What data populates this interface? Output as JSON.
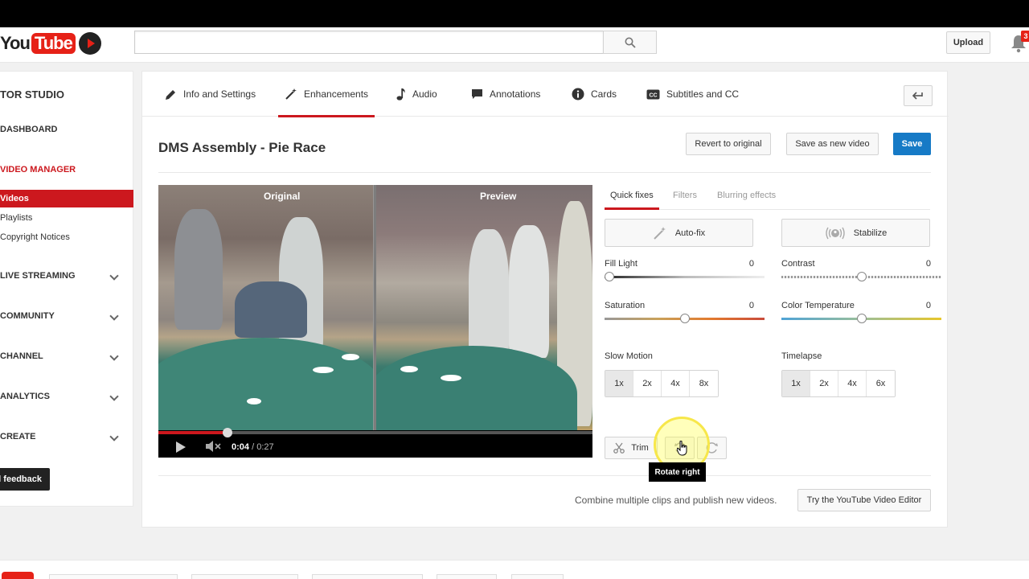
{
  "masthead": {
    "logo_you": "You",
    "logo_tube": "Tube",
    "upload_label": "Upload",
    "notification_count": "3"
  },
  "sidebar": {
    "title": "TOR STUDIO",
    "dashboard": "DASHBOARD",
    "video_manager": "VIDEO MANAGER",
    "items": [
      {
        "label": "Videos"
      },
      {
        "label": "Playlists"
      },
      {
        "label": "Copyright Notices"
      }
    ],
    "sections": [
      {
        "label": "LIVE STREAMING"
      },
      {
        "label": "COMMUNITY"
      },
      {
        "label": "CHANNEL"
      },
      {
        "label": "ANALYTICS"
      },
      {
        "label": "CREATE"
      }
    ],
    "feedback": "d feedback"
  },
  "tabs": [
    {
      "label": "Info and Settings"
    },
    {
      "label": "Enhancements"
    },
    {
      "label": "Audio"
    },
    {
      "label": "Annotations"
    },
    {
      "label": "Cards"
    },
    {
      "label": "Subtitles and CC"
    }
  ],
  "video": {
    "title": "DMS Assembly - Pie Race",
    "original_label": "Original",
    "preview_label": "Preview",
    "current_time": "0:04",
    "total_time": "/ 0:27",
    "progress_fraction": 0.16
  },
  "actions": {
    "revert": "Revert to original",
    "save_new": "Save as new video",
    "save": "Save"
  },
  "enhance": {
    "tabs": [
      "Quick fixes",
      "Filters",
      "Blurring effects"
    ],
    "autofix": "Auto-fix",
    "stabilize": "Stabilize",
    "sliders": [
      {
        "label": "Fill Light",
        "value": "0",
        "level": 0.0
      },
      {
        "label": "Contrast",
        "value": "0",
        "level": 0.5
      },
      {
        "label": "Saturation",
        "value": "0",
        "level": 0.5
      },
      {
        "label": "Color Temperature",
        "value": "0",
        "level": 0.5
      }
    ],
    "slow_motion_label": "Slow Motion",
    "slow_motion_options": [
      "1x",
      "2x",
      "4x",
      "8x"
    ],
    "timelapse_label": "Timelapse",
    "timelapse_options": [
      "1x",
      "2x",
      "4x",
      "6x"
    ],
    "trim": "Trim",
    "tooltip": "Rotate right"
  },
  "footer": {
    "combine_text": "Combine multiple clips and publish new videos.",
    "editor_button": "Try the YouTube Video Editor"
  },
  "colors": {
    "accent_red": "#cc181e",
    "save_blue": "#167ac6"
  }
}
